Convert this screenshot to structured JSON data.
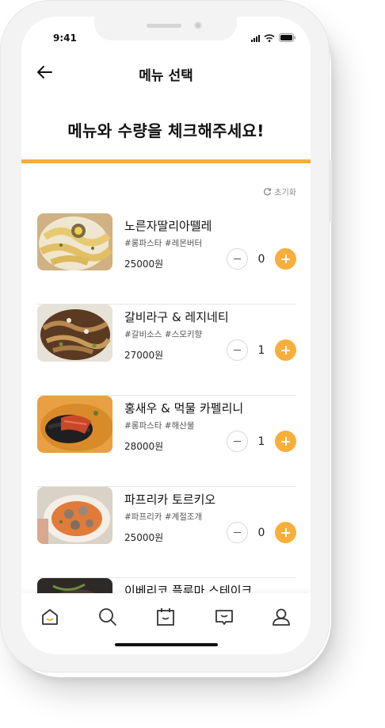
{
  "status_bar": {
    "time": "9:41"
  },
  "header": {
    "title": "메뉴 선택",
    "back_icon": "arrow-left-icon"
  },
  "headline": "메뉴와 수량을 체크해주세요!",
  "colors": {
    "accent": "#F7AE3B",
    "text": "#111111"
  },
  "reset": {
    "label": "초기화",
    "icon": "refresh-icon"
  },
  "menu": [
    {
      "name": "노른자딸리아뗄레",
      "tags": "#롱파스타 #레몬버터",
      "price": "25000원",
      "qty": "0"
    },
    {
      "name": "갈비라구 & 레지네티",
      "tags": "#갈비소스 #스모키향",
      "price": "27000원",
      "qty": "1"
    },
    {
      "name": "홍새우 & 먹물 카펠리니",
      "tags": "#롱파스타 #해산물",
      "price": "28000원",
      "qty": "1"
    },
    {
      "name": "파프리카 토르키오",
      "tags": "#파프리카 #계절조개",
      "price": "25000원",
      "qty": "0"
    },
    {
      "name": "이베리코 플루마 스테이크"
    }
  ],
  "bottom_nav": [
    "home-icon",
    "search-icon",
    "calendar-icon",
    "chat-icon",
    "user-icon"
  ]
}
